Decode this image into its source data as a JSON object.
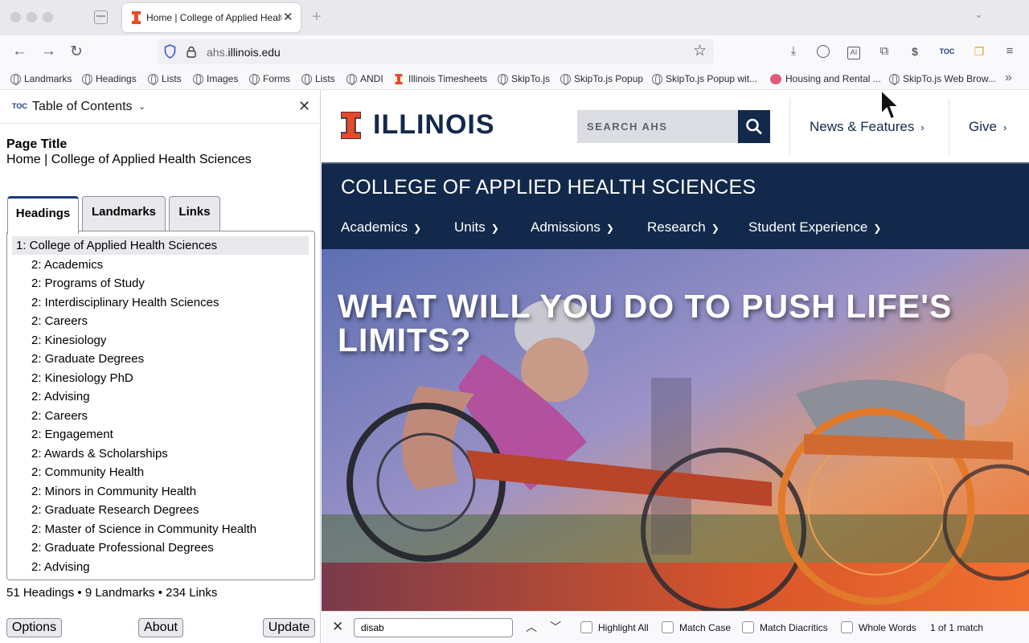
{
  "browser": {
    "tab_title": "Home | College of Applied Health Sciences",
    "url_prefix": "ahs.",
    "url_domain": "illinois.edu",
    "toc_tool_label": "TOC"
  },
  "bookmarks": [
    {
      "label": "Landmarks"
    },
    {
      "label": "Headings"
    },
    {
      "label": "Lists"
    },
    {
      "label": "Images"
    },
    {
      "label": "Forms"
    },
    {
      "label": "Lists"
    },
    {
      "label": "ANDI"
    },
    {
      "label": "Illinois Timesheets"
    },
    {
      "label": "SkipTo.js"
    },
    {
      "label": "SkipTo.js Popup"
    },
    {
      "label": "SkipTo.js Popup wit..."
    },
    {
      "label": "Housing and Rental ..."
    },
    {
      "label": "SkipTo.js Web Brow..."
    }
  ],
  "sidebar": {
    "icon_label": "TOC",
    "title": "Table of Contents",
    "page_title_label": "Page Title",
    "page_title_value": "Home | College of Applied Health Sciences",
    "tabs": [
      {
        "label": "Headings",
        "active": true
      },
      {
        "label": "Landmarks",
        "active": false
      },
      {
        "label": "Links",
        "active": false
      }
    ],
    "headings": [
      "1: College of Applied Health Sciences",
      "2: Academics",
      "2: Programs of Study",
      "2: Interdisciplinary Health Sciences",
      "2: Careers",
      "2: Kinesiology",
      "2: Graduate Degrees",
      "2: Kinesiology PhD",
      "2: Advising",
      "2: Careers",
      "2: Engagement",
      "2: Awards & Scholarships",
      "2: Community Health",
      "2: Minors in Community Health",
      "2: Graduate Research Degrees",
      "2: Master of Science in Community Health",
      "2: Graduate Professional Degrees",
      "2: Advising"
    ],
    "summary": "51 Headings • 9 Landmarks • 234 Links",
    "buttons": {
      "options": "Options",
      "about": "About",
      "update": "Update"
    }
  },
  "site": {
    "logo_text": "ILLINOIS",
    "search_placeholder": "SEARCH AHS",
    "header_links": [
      {
        "label": "News & Features"
      },
      {
        "label": "Give"
      }
    ],
    "college_name": "COLLEGE OF APPLIED HEALTH SCIENCES",
    "main_nav": [
      {
        "label": "Academics"
      },
      {
        "label": "Units"
      },
      {
        "label": "Admissions"
      },
      {
        "label": "Research"
      },
      {
        "label": "Student Experience"
      }
    ],
    "hero_headline": "WHAT WILL YOU DO TO PUSH LIFE'S LIMITS?",
    "colors": {
      "blue": "#13294b",
      "orange": "#e84a27"
    }
  },
  "findbar": {
    "query": "disab",
    "options": [
      "Highlight All",
      "Match Case",
      "Match Diacritics",
      "Whole Words"
    ],
    "result": "1 of 1 match"
  }
}
